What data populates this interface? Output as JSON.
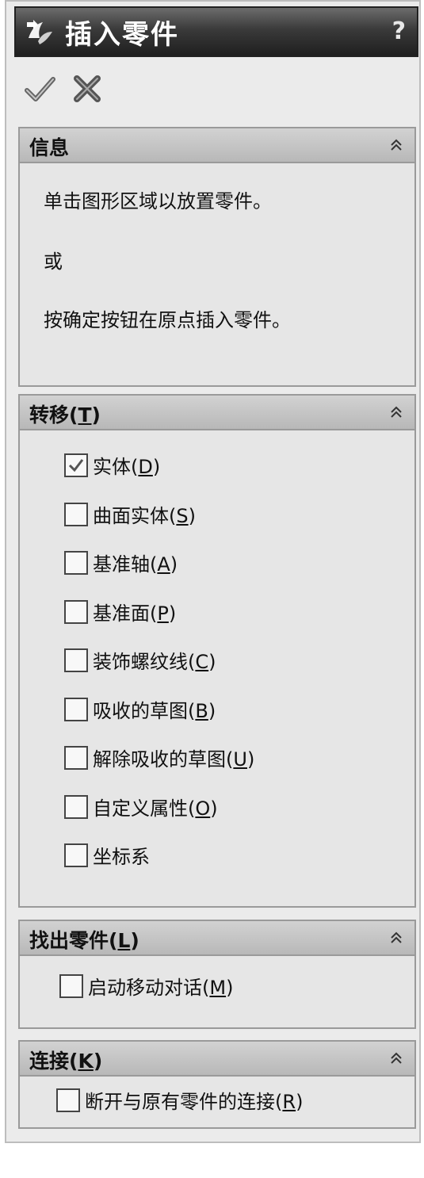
{
  "title": "插入零件",
  "help_label": "?",
  "toolbar": {
    "ok_icon": "checkmark-icon",
    "cancel_icon": "x-icon"
  },
  "info": {
    "header": "信息",
    "lines": [
      "单击图形区域以放置零件。",
      "或",
      "按确定按钮在原点插入零件。"
    ]
  },
  "transfer": {
    "header": "转移",
    "header_key": "T",
    "items": [
      {
        "label": "实体",
        "key": "D",
        "checked": true
      },
      {
        "label": "曲面实体",
        "key": "S",
        "checked": false
      },
      {
        "label": "基准轴",
        "key": "A",
        "checked": false
      },
      {
        "label": "基准面",
        "key": "P",
        "checked": false
      },
      {
        "label": "装饰螺纹线",
        "key": "C",
        "checked": false
      },
      {
        "label": "吸收的草图",
        "key": "B",
        "checked": false
      },
      {
        "label": "解除吸收的草图",
        "key": "U",
        "checked": false
      },
      {
        "label": "自定义属性",
        "key": "O",
        "checked": false
      },
      {
        "label": "坐标系",
        "key": "",
        "checked": false
      }
    ]
  },
  "locate": {
    "header": "找出零件",
    "header_key": "L",
    "item": {
      "label": "启动移动对话",
      "key": "M",
      "checked": false
    }
  },
  "link": {
    "header": "连接",
    "header_key": "K",
    "item": {
      "label": "断开与原有零件的连接",
      "key": "R",
      "checked": false
    }
  }
}
